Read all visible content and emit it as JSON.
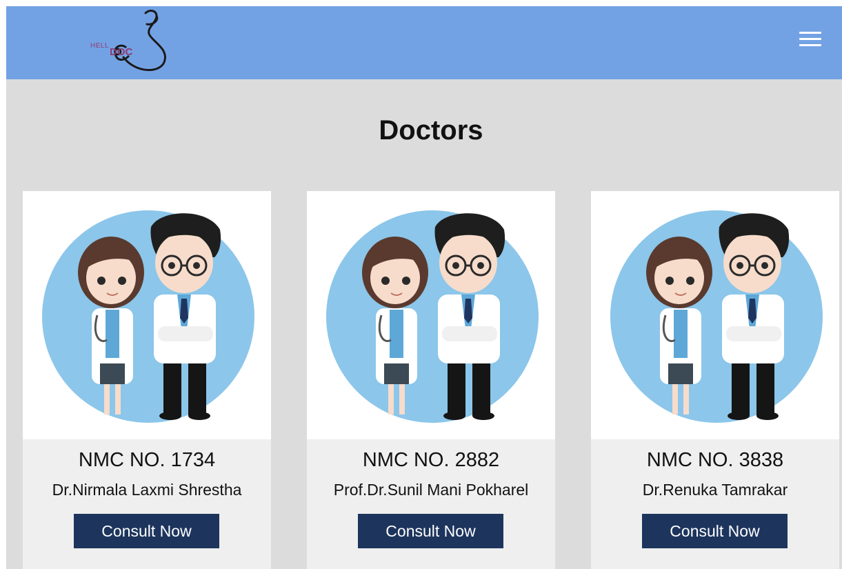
{
  "navbar": {
    "logo_text_top": "HELL",
    "logo_text_bottom": "DOC",
    "menu_icon": "hamburger-menu-icon",
    "bg_color": "#73a2e4"
  },
  "page": {
    "title": "Doctors",
    "bg_color": "#dcdcdc"
  },
  "doctors": [
    {
      "nmc": "NMC NO. 1734",
      "name": "Dr.Nirmala Laxmi Shrestha",
      "button": "Consult Now",
      "image_icon": "doctors-illustration-icon"
    },
    {
      "nmc": "NMC NO. 2882",
      "name": "Prof.Dr.Sunil Mani Pokharel",
      "button": "Consult Now",
      "image_icon": "doctors-illustration-icon"
    },
    {
      "nmc": "NMC NO. 3838",
      "name": "Dr.Renuka Tamrakar",
      "button": "Consult Now",
      "image_icon": "doctors-illustration-icon"
    }
  ],
  "colors": {
    "button_bg": "#1d355d",
    "circle_bg": "#8cc6ea"
  }
}
